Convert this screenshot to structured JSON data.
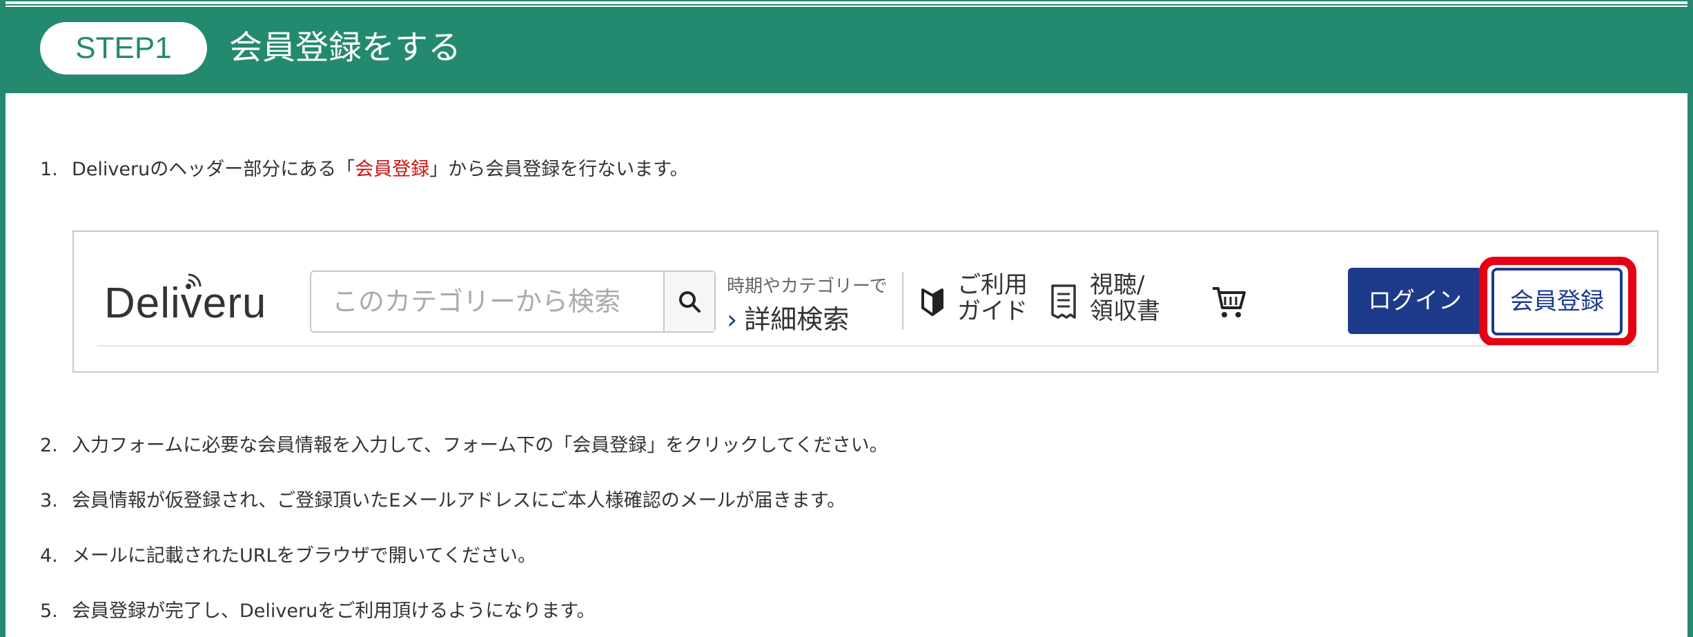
{
  "banner": {
    "step_label": "STEP1",
    "title": "会員登録をする"
  },
  "steps": [
    {
      "num": "1.",
      "pre": "Deliveruのヘッダー部分にある「",
      "highlight": "会員登録",
      "post": "」から会員登録を行ないます。"
    },
    {
      "num": "2.",
      "text": "入力フォームに必要な会員情報を入力して、フォーム下の「会員登録」をクリックしてください。"
    },
    {
      "num": "3.",
      "text": "会員情報が仮登録され、ご登録頂いたEメールアドレスにご本人様確認のメールが届きます。"
    },
    {
      "num": "4.",
      "text": "メールに記載されたURLをブラウザで開いてください。"
    },
    {
      "num": "5.",
      "text": "会員登録が完了し、Deliveruをご利用頂けるようになります。"
    }
  ],
  "header_mock": {
    "logo": "Deliveru",
    "search_placeholder": "このカテゴリーから検索",
    "search_icon": "search-icon",
    "advanced_hint": "時期やカテゴリーで",
    "advanced_chevron": "›",
    "advanced_label": "詳細検索",
    "guide_line1": "ご利用",
    "guide_line2": "ガイド",
    "receipt_line1": "視聴/",
    "receipt_line2": "領収書",
    "cart_icon": "cart-icon",
    "login_label": "ログイン",
    "register_label": "会員登録"
  },
  "colors": {
    "brand_green": "#23896f",
    "navy": "#1e3a8a",
    "highlight_red": "#e60012",
    "text_red": "#cc1111"
  }
}
